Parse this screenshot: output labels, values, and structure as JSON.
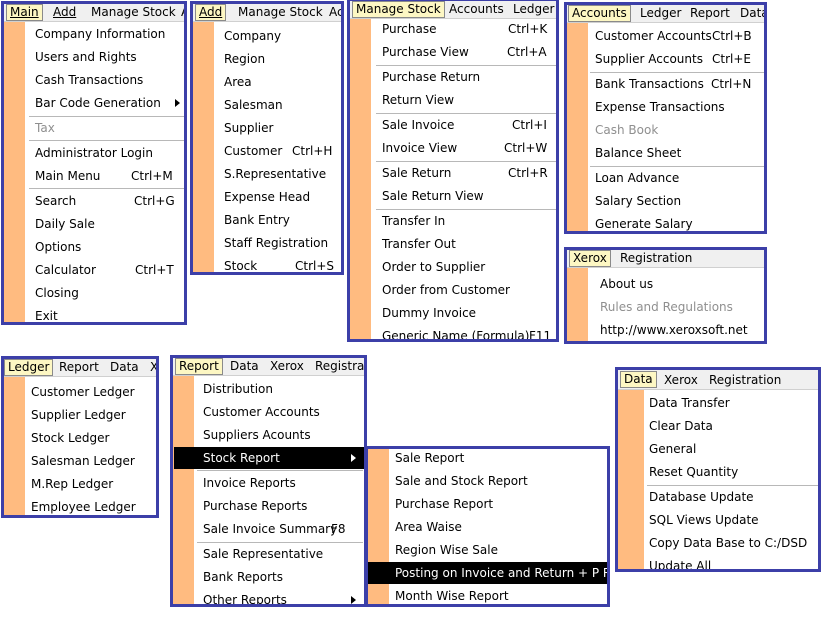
{
  "main_menu": {
    "bar": [
      "Main",
      "Add",
      "Manage Stock",
      "A"
    ],
    "items": {
      "company_information": "Company Information",
      "users_and_rights": "Users and Rights",
      "cash_transactions": "Cash Transactions",
      "bar_code_generation": "Bar Code Generation",
      "tax": "Tax",
      "administrator_login": "Administrator Login",
      "main_menu": "Main Menu",
      "main_menu_sc": "Ctrl+M",
      "search": "Search",
      "search_sc": "Ctrl+G",
      "daily_sale": "Daily  Sale",
      "options": "Options",
      "calculator": "Calculator",
      "calculator_sc": "Ctrl+T",
      "closing": "Closing",
      "exit": "Exit"
    }
  },
  "add_menu": {
    "bar": [
      "Add",
      "Manage Stock",
      "Acc"
    ],
    "items": {
      "company": "Company",
      "region": "Region",
      "area": "Area",
      "salesman": "Salesman",
      "supplier": "Supplier",
      "customer": "Customer",
      "customer_sc": "Ctrl+H",
      "s_representative": "S.Representative",
      "expense_head": "Expense Head",
      "bank_entry": "Bank Entry",
      "staff_registration": "Staff Registration",
      "stock": "Stock",
      "stock_sc": "Ctrl+S"
    }
  },
  "manage_stock_menu": {
    "bar": [
      "Manage Stock",
      "Accounts",
      "Ledger"
    ],
    "items": {
      "purchase": "Purchase",
      "purchase_sc": "Ctrl+K",
      "purchase_view": "Purchase View",
      "purchase_view_sc": "Ctrl+A",
      "purchase_return": "Purchase Return",
      "return_view": "Return View",
      "sale_invoice": "Sale Invoice",
      "sale_invoice_sc": "Ctrl+I",
      "invoice_view": "Invoice View",
      "invoice_view_sc": "Ctrl+W",
      "sale_return": "Sale Return",
      "sale_return_sc": "Ctrl+R",
      "sale_return_view": "Sale Return View",
      "transfer_in": "Transfer In",
      "transfer_out": "Transfer Out",
      "order_to_supplier": "Order to Supplier",
      "order_from_customer": "Order from Customer",
      "dummy_invoice": "Dummy Invoice",
      "generic_name": "Generic Name (Formula)",
      "generic_name_sc": "F11"
    }
  },
  "accounts_menu": {
    "bar": [
      "Accounts",
      "Ledger",
      "Report",
      "Data"
    ],
    "items": {
      "customer_accounts": "Customer Accounts",
      "customer_accounts_sc": "Ctrl+B",
      "supplier_accounts": "Supplier Accounts",
      "supplier_accounts_sc": "Ctrl+E",
      "bank_transactions": "Bank Transactions",
      "bank_transactions_sc": "Ctrl+N",
      "expense_transactions": "Expense Transactions",
      "cash_book": "Cash Book",
      "balance_sheet": "Balance Sheet",
      "loan_advance": "Loan Advance",
      "salary_section": "Salary Section",
      "generate_salary": "Generate Salary"
    }
  },
  "xerox_menu": {
    "bar": [
      "Xerox",
      "Registration"
    ],
    "items": {
      "about_us": "About us",
      "rules_and_regulations": "Rules and Regulations",
      "website": "http://www.xeroxsoft.net"
    }
  },
  "ledger_menu": {
    "bar": [
      "Ledger",
      "Report",
      "Data",
      "X"
    ],
    "items": {
      "customer_ledger": "Customer Ledger",
      "supplier_ledger": "Supplier Ledger",
      "stock_ledger": "Stock Ledger",
      "salesman_ledger": "Salesman Ledger",
      "mrep_ledger": "M.Rep Ledger",
      "employee_ledger": "Employee Ledger"
    }
  },
  "report_menu": {
    "bar": [
      "Report",
      "Data",
      "Xerox",
      "Registrati"
    ],
    "items": {
      "distribution": "Distribution",
      "customer_accounts": "Customer Accounts",
      "suppliers_acounts": "Suppliers Acounts",
      "stock_report": "Stock Report",
      "invoice_reports": "Invoice Reports",
      "purchase_reports": "Purchase Reports",
      "sale_invoice_summary": "Sale Invoice Summary",
      "sale_invoice_summary_sc": "F8",
      "sale_representative": "Sale Representative",
      "bank_reports": "Bank Reports",
      "other_reports": "Other Reports"
    }
  },
  "stock_report_submenu": {
    "items": {
      "sale_report": "Sale Report",
      "sale_and_stock_report": "Sale and Stock Report",
      "purchase_report": "Purchase Report",
      "area_waise": "Area Waise",
      "region_wise_sale": "Region Wise Sale",
      "posting_on_invoice": "Posting on Invoice and Return + P R S",
      "month_wise_report": "Month Wise Report"
    }
  },
  "data_menu": {
    "bar": [
      "Data",
      "Xerox",
      "Registration"
    ],
    "items": {
      "data_transfer": "Data Transfer",
      "clear_data": "Clear Data",
      "general": "General",
      "reset_quantity": "Reset Quantity",
      "database_update": "Database Update",
      "sql_views_update": "SQL Views Update",
      "copy_data_base": "Copy Data Base to C:/DSD",
      "update_all": "Update All"
    }
  },
  "colors": {
    "border": "#3c3fa8",
    "strip": "#ffbb80",
    "selected_top": "#fdf7c3",
    "highlight": "#000000",
    "disabled": "#8f8f8f"
  }
}
